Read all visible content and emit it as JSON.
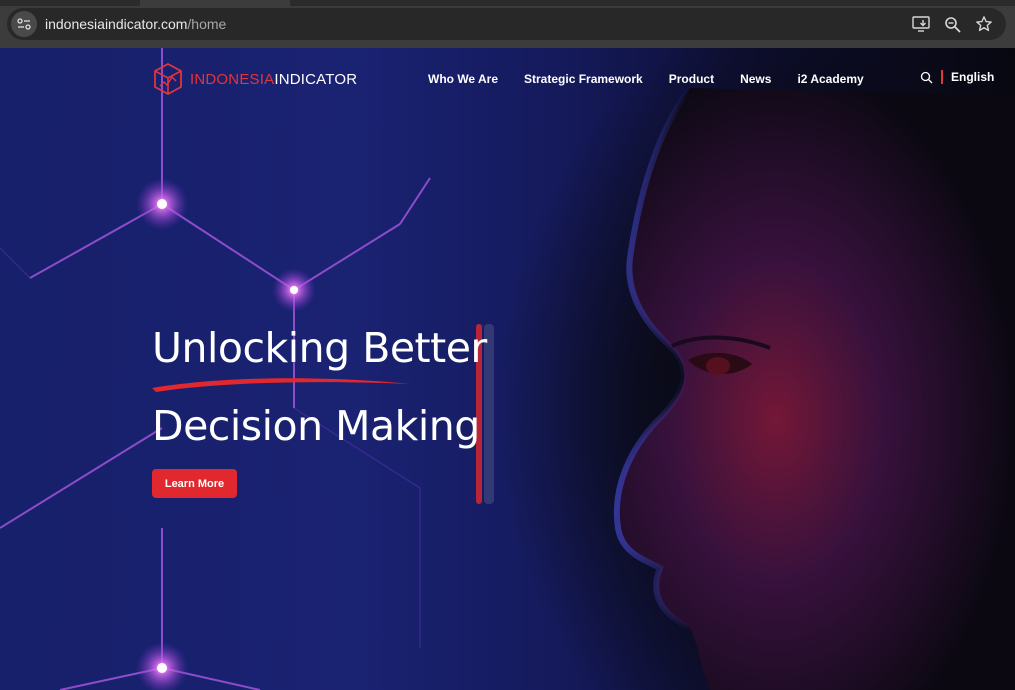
{
  "browser": {
    "url_host": "indonesiaindicator.com",
    "url_path": "/home",
    "icons": [
      "site-info-icon",
      "install-app-icon",
      "zoom-icon",
      "bookmark-star-icon"
    ]
  },
  "header": {
    "logo_part1": "INDONESIA",
    "logo_part2": "INDICATOR",
    "nav": [
      "Who We Are",
      "Strategic Framework",
      "Product",
      "News",
      "i2 Academy"
    ],
    "language": "English"
  },
  "hero": {
    "line1": "Unlocking Better",
    "line2": "Decision Making",
    "cta_label": "Learn More"
  },
  "colors": {
    "accent": "#e1282e",
    "background": "#17206a",
    "text": "#ffffff"
  }
}
